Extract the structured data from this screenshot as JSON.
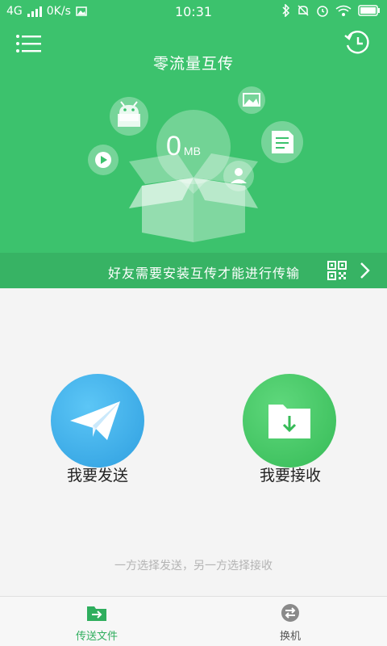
{
  "status_bar": {
    "network": "4G",
    "speed": "0K/s",
    "time": "10:31",
    "icons": [
      "signal-icon",
      "image-notification-icon",
      "bluetooth-icon",
      "mute-icon",
      "alarm-icon",
      "wifi-icon",
      "battery-icon"
    ]
  },
  "header": {
    "title": "零流量互传",
    "menu_icon": "menu-icon",
    "history_icon": "history-icon",
    "illustration": {
      "size_value": "0",
      "size_unit": "MB",
      "floating_icons": [
        "android-icon",
        "image-icon",
        "document-icon",
        "video-icon",
        "contact-icon"
      ]
    }
  },
  "notice": {
    "text": "好友需要安装互传才能进行传输",
    "qr_icon": "qr-code-icon",
    "arrow_icon": "chevron-right-icon"
  },
  "actions": {
    "send_label": "我要发送",
    "receive_label": "我要接收",
    "send_icon": "paper-plane-icon",
    "receive_icon": "folder-download-icon"
  },
  "hint": "一方选择发送，另一方选择接收",
  "tabs": [
    {
      "label": "传送文件",
      "icon": "folder-transfer-icon",
      "active": true
    },
    {
      "label": "换机",
      "icon": "swap-icon",
      "active": false
    }
  ],
  "colors": {
    "header_green": "#3cc26d",
    "notice_green": "#37b364",
    "send_blue": "#2f9fe0",
    "receive_green": "#36bb57",
    "active_tab": "#2fae5e"
  }
}
